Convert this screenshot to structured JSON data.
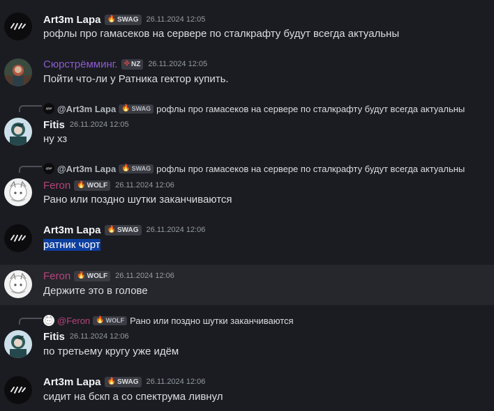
{
  "colors": {
    "background": "#1b1c21",
    "hover_background": "#26272c",
    "default_name": "#f2f3f5",
    "syurstremming_name": "#8b5bd0",
    "feron_name": "#b6447a",
    "timestamp": "#949ba4",
    "selection": "#0d3fa0"
  },
  "messages": [
    {
      "author": "Art3m Lapa",
      "tag_icon": "flame-icon",
      "tag": "SWAG",
      "time": "26.11.2024 12:05",
      "text": "рофлы про гамасеков на сервере по сталкрафту будут всегда актуальны"
    },
    {
      "author": "Сюрстрёмминг.",
      "tag_icon": "crosshair-icon",
      "tag": "NZ",
      "time": "26.11.2024 12:05",
      "text": "Пойти что-ли у Ратника гектор купить."
    },
    {
      "reply": {
        "author": "@Art3m Lapa",
        "tag": "SWAG",
        "text": "рофлы про гамасеков на сервере по сталкрафту будут всегда актуальны"
      },
      "author": "Fitis",
      "time": "26.11.2024 12:05",
      "text": "ну хз"
    },
    {
      "reply": {
        "author": "@Art3m Lapa",
        "tag": "SWAG",
        "text": "рофлы про гамасеков на сервере по сталкрафту будут всегда актуальны"
      },
      "author": "Feron",
      "tag_icon": "flame-icon",
      "tag": "WOLF",
      "time": "26.11.2024 12:06",
      "text": "Рано или поздно шутки заканчиваются"
    },
    {
      "author": "Art3m Lapa",
      "tag_icon": "flame-icon",
      "tag": "SWAG",
      "time": "26.11.2024 12:06",
      "text": "ратник чорт"
    },
    {
      "author": "Feron",
      "tag_icon": "flame-icon",
      "tag": "WOLF",
      "time": "26.11.2024 12:06",
      "text": "Держите это в голове"
    },
    {
      "reply": {
        "author": "@Feron",
        "tag": "WOLF",
        "text": "Рано или поздно шутки заканчиваются"
      },
      "author": "Fitis",
      "time": "26.11.2024 12:06",
      "text": "по третьему кругу уже идём"
    },
    {
      "author": "Art3m Lapa",
      "tag_icon": "flame-icon",
      "tag": "SWAG",
      "time": "26.11.2024 12:06",
      "text": "сидит на бскп а со спектрума ливнул"
    }
  ]
}
